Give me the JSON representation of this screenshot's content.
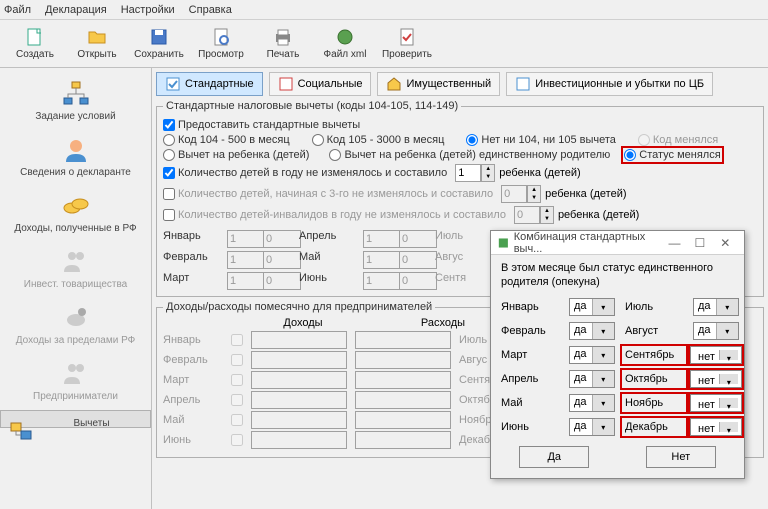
{
  "menu": {
    "file": "Файл",
    "decl": "Декларация",
    "settings": "Настройки",
    "help": "Справка"
  },
  "toolbar": {
    "create": "Создать",
    "open": "Открыть",
    "save": "Сохранить",
    "preview": "Просмотр",
    "print": "Печать",
    "filexml": "Файл xml",
    "check": "Проверить"
  },
  "sidebar": {
    "task": "Задание условий",
    "declarant": "Сведения о декларанте",
    "income_rf": "Доходы, полученные в РФ",
    "invest": "Инвест. товарищества",
    "income_abroad": "Доходы за пределами РФ",
    "entrepr": "Предприниматели",
    "deductions": "Вычеты"
  },
  "tabs": {
    "standard": "Стандартные",
    "social": "Социальные",
    "property": "Имущественный",
    "invest_cb": "Инвестиционные и убытки по ЦБ"
  },
  "fs1": {
    "legend": "Стандартные налоговые вычеты (коды 104-105, 114-149)",
    "provide": "Предоставить стандартные вычеты",
    "r1_a": "Код 104 - 500 в месяц",
    "r1_b": "Код 105 - 3000 в месяц",
    "r1_c": "Нет ни 104, ни 105 вычета",
    "r1_d": "Код менялся",
    "r2_a": "Вычет на ребенка (детей)",
    "r2_b": "Вычет на ребенка (детей) единственному родителю",
    "r2_c": "Статус менялся",
    "c1": "Количество детей в году не изменялось и составило",
    "c1_suffix": "ребенка (детей)",
    "c2": "Количество детей, начиная с 3-го не изменялось и составило",
    "c2_suffix": "ребенка (детей)",
    "c3": "Количество детей-инвалидов в году не изменялось и составило",
    "c3_suffix": "ребенка (детей)",
    "val_c1": "1",
    "val_c2": "0",
    "val_c3": "0"
  },
  "months": {
    "jan": "Январь",
    "feb": "Февраль",
    "mar": "Март",
    "apr": "Апрель",
    "may": "Май",
    "jun": "Июнь",
    "jul": "Июль",
    "aug": "Август",
    "sep": "Сентябрь",
    "oct": "Октябрь",
    "nov": "Ноябрь",
    "dec": "Декабрь"
  },
  "mvals": {
    "a": "1",
    "b": "0"
  },
  "section2": {
    "title": "Доходы/расходы помесячно для предпринимателей",
    "income": "Доходы",
    "expense": "Расходы"
  },
  "dialog": {
    "title": "Комбинация стандартных выч...",
    "msg": "В этом месяце был статус единственного родителя (опекуна)",
    "yes": "да",
    "no": "нет",
    "btn_yes": "Да",
    "btn_no": "Нет"
  }
}
